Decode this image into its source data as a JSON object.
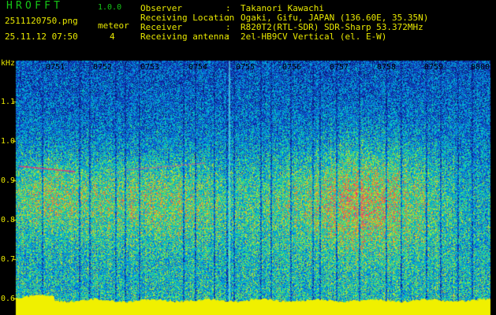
{
  "app": {
    "title": "HROFFT",
    "version": "1.0.0"
  },
  "capture": {
    "file": "2511120750.png",
    "datetime": "25.11.12 07:50"
  },
  "meteor": {
    "label": "meteor",
    "count": "4"
  },
  "info": [
    {
      "key": "Observer",
      "value": "Takanori Kawachi"
    },
    {
      "key": "Receiving Location",
      "value": "Ogaki, Gifu, JAPAN (136.60E, 35.35N)"
    },
    {
      "key": "Receiver",
      "value": "R820T2(RTL-SDR) SDR-Sharp 53.372MHz"
    },
    {
      "key": "Receiving antenna",
      "value": "2el-HB9CV Vertical (el. E-W)"
    }
  ],
  "axis": {
    "y_unit": "kHz",
    "y_ticks": [
      "1.1",
      "1.0",
      "0.9",
      "0.8",
      "0.7",
      "0.6"
    ],
    "x_ticks": [
      "0751",
      "0752",
      "0753",
      "0754",
      "0755",
      "0756",
      "0757",
      "0758",
      "0759",
      "0800"
    ]
  },
  "colors": {
    "label_green": "#16c616",
    "label_yellow": "#e8e800",
    "floor": "#f0f000"
  }
}
